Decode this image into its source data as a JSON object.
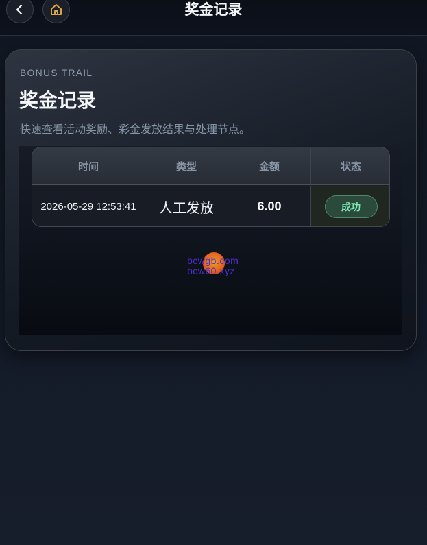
{
  "header": {
    "title": "奖金记录",
    "back_icon": "chevron-left-icon",
    "home_icon": "home-icon",
    "accent_color": "#d9a441"
  },
  "card": {
    "eyebrow": "BONUS TRAIL",
    "title": "奖金记录",
    "description": "快速查看活动奖励、彩金发放结果与处理节点。"
  },
  "table": {
    "columns": [
      "时间",
      "类型",
      "金额",
      "状态"
    ],
    "rows": [
      {
        "time": "2026-05-29 12:53:41",
        "type": "人工发放",
        "amount": "6.00",
        "status": "成功",
        "status_color": "#7fe8b4"
      }
    ]
  },
  "watermark": {
    "line1": "bcwgb.com",
    "line2": "bcw60.xyz"
  }
}
